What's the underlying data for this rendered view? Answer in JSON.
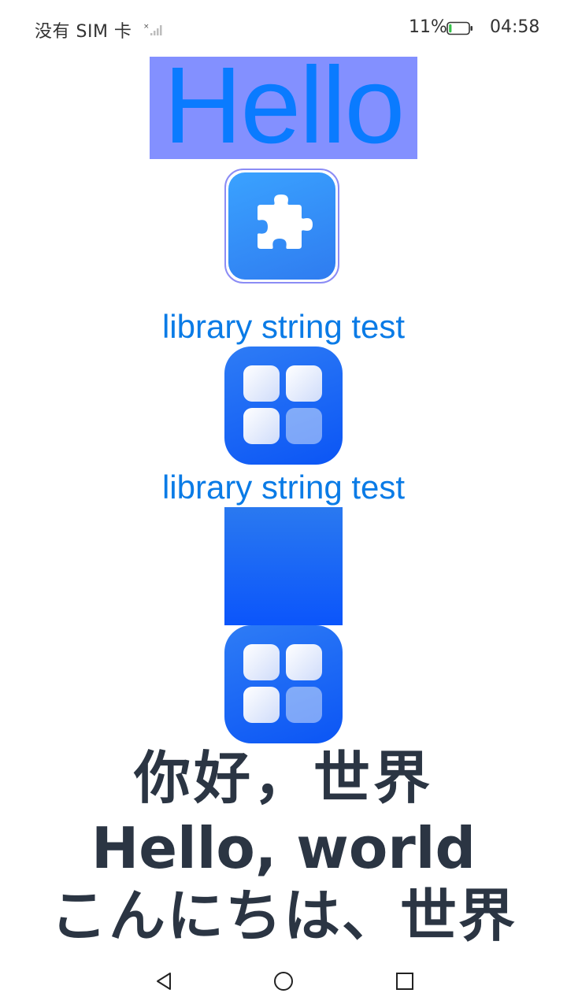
{
  "status_bar": {
    "carrier": "没有 SIM 卡",
    "battery_percent": "11%",
    "battery_level": 0.11,
    "time": "04:58",
    "signal_icon": "signal-none-icon",
    "battery_icon": "battery-low-icon"
  },
  "main": {
    "hello_text": "Hello",
    "hello_bg_color": "#8390ff",
    "hello_text_color": "#0a7bff",
    "puzzle_icon": "puzzle-icon",
    "library_string_1": "library string test",
    "apps_icon": "apps-grid-icon",
    "library_string_2": "library string test",
    "greetings": {
      "chinese": "你好，世界",
      "english": "Hello, world",
      "japanese": "こんにちは、世界"
    }
  },
  "nav_bar": {
    "back_icon": "back-triangle-icon",
    "home_icon": "home-circle-icon",
    "recent_icon": "recent-square-icon"
  }
}
